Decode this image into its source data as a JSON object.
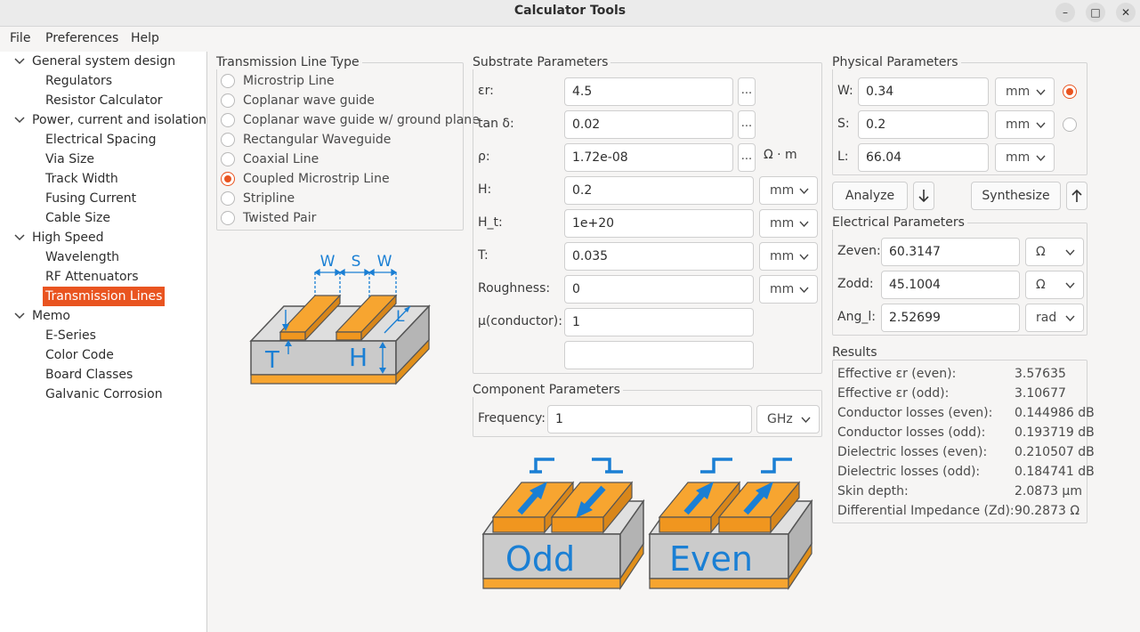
{
  "window": {
    "title": "Calculator Tools",
    "minimize_glyph": "–",
    "maximize_glyph": "□",
    "close_glyph": "✕"
  },
  "menu": [
    "File",
    "Preferences",
    "Help"
  ],
  "tree": [
    {
      "label": "General system design",
      "children": [
        "Regulators",
        "Resistor Calculator"
      ]
    },
    {
      "label": "Power, current and isolation",
      "children": [
        "Electrical Spacing",
        "Via Size",
        "Track Width",
        "Fusing Current",
        "Cable Size"
      ]
    },
    {
      "label": "High Speed",
      "children": [
        "Wavelength",
        "RF Attenuators",
        "Transmission Lines"
      ]
    },
    {
      "label": "Memo",
      "children": [
        "E-Series",
        "Color Code",
        "Board Classes",
        "Galvanic Corrosion"
      ]
    }
  ],
  "tree_selected": "Transmission Lines",
  "line_type": {
    "title": "Transmission Line Type",
    "options": [
      "Microstrip Line",
      "Coplanar wave guide",
      "Coplanar wave guide w/ ground plane",
      "Rectangular Waveguide",
      "Coaxial Line",
      "Coupled Microstrip Line",
      "Stripline",
      "Twisted Pair"
    ],
    "selected_index": 5
  },
  "diagram": {
    "w1": "W",
    "s": "S",
    "w2": "W",
    "l": "L",
    "t": "T",
    "h": "H"
  },
  "substrate": {
    "title": "Substrate Parameters",
    "rows": [
      {
        "label": "εr:",
        "value": "4.5",
        "dots": "...",
        "unit": ""
      },
      {
        "label": "tan δ:",
        "value": "0.02",
        "dots": "...",
        "unit": ""
      },
      {
        "label": "ρ:",
        "value": "1.72e-08",
        "dots": "...",
        "unit": "Ω · m"
      },
      {
        "label": "H:",
        "value": "0.2",
        "unit": "mm"
      },
      {
        "label": "H_t:",
        "value": "1e+20",
        "unit": "mm"
      },
      {
        "label": "T:",
        "value": "0.035",
        "unit": "mm"
      },
      {
        "label": "Roughness:",
        "value": "0",
        "unit": "mm"
      },
      {
        "label": "μ(conductor):",
        "value": "1",
        "unit": ""
      },
      {
        "label": "",
        "value": "",
        "unit": ""
      }
    ]
  },
  "component": {
    "title": "Component Parameters",
    "label": "Frequency:",
    "value": "1",
    "unit": "GHz"
  },
  "modes": {
    "odd": "Odd",
    "even": "Even"
  },
  "physical": {
    "title": "Physical Parameters",
    "rows": [
      {
        "label": "W:",
        "value": "0.34",
        "unit": "mm",
        "selected": true
      },
      {
        "label": "S:",
        "value": "0.2",
        "unit": "mm",
        "selected": false
      },
      {
        "label": "L:",
        "value": "66.04",
        "unit": "mm"
      }
    ]
  },
  "actions": {
    "analyze": "Analyze",
    "synthesize": "Synthesize"
  },
  "electrical": {
    "title": "Electrical Parameters",
    "rows": [
      {
        "label": "Zeven:",
        "value": "60.3147",
        "unit": "Ω"
      },
      {
        "label": "Zodd:",
        "value": "45.1004",
        "unit": "Ω"
      },
      {
        "label": "Ang_l:",
        "value": "2.52699",
        "unit": "rad"
      }
    ]
  },
  "results": {
    "title": "Results",
    "rows": [
      {
        "label": "Effective εr (even):",
        "value": "3.57635"
      },
      {
        "label": "Effective εr (odd):",
        "value": "3.10677"
      },
      {
        "label": "Conductor losses (even):",
        "value": "0.144986 dB"
      },
      {
        "label": "Conductor losses (odd):",
        "value": "0.193719 dB"
      },
      {
        "label": "Dielectric losses (even):",
        "value": "0.210507 dB"
      },
      {
        "label": "Dielectric losses (odd):",
        "value": "0.184741 dB"
      },
      {
        "label": "Skin depth:",
        "value": "2.0873 μm"
      },
      {
        "label": "Differential Impedance (Zd):",
        "value": "90.2873 Ω"
      }
    ]
  },
  "colors": {
    "accent": "#e95420",
    "copper": "#f7a530",
    "diagram_blue": "#1a7fd4",
    "substrate_gray": "#c9c9c9"
  }
}
